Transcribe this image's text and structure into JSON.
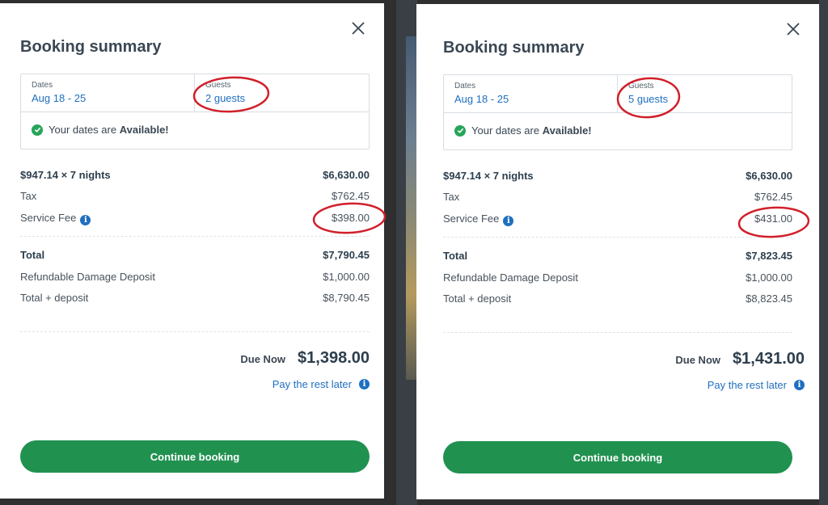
{
  "panels": [
    {
      "title": "Booking summary",
      "dates_label": "Dates",
      "dates_value": "Aug 18 - 25",
      "guests_label": "Guests",
      "guests_value": "2 guests",
      "available_prefix": "Your dates are ",
      "available_bold": "Available!",
      "lines": {
        "nights_label": "$947.14 × 7 nights",
        "nights_value": "$6,630.00",
        "tax_label": "Tax",
        "tax_value": "$762.45",
        "fee_label": "Service Fee",
        "fee_value": "$398.00",
        "total_label": "Total",
        "total_value": "$7,790.45",
        "deposit_label": "Refundable Damage Deposit",
        "deposit_value": "$1,000.00",
        "total_deposit_label": "Total + deposit",
        "total_deposit_value": "$8,790.45"
      },
      "due_label": "Due Now",
      "due_value": "$1,398.00",
      "pay_later": "Pay the rest later",
      "cta": "Continue booking"
    },
    {
      "title": "Booking summary",
      "dates_label": "Dates",
      "dates_value": "Aug 18 - 25",
      "guests_label": "Guests",
      "guests_value": "5 guests",
      "available_prefix": "Your dates are ",
      "available_bold": "Available!",
      "lines": {
        "nights_label": "$947.14 × 7 nights",
        "nights_value": "$6,630.00",
        "tax_label": "Tax",
        "tax_value": "$762.45",
        "fee_label": "Service Fee",
        "fee_value": "$431.00",
        "total_label": "Total",
        "total_value": "$7,823.45",
        "deposit_label": "Refundable Damage Deposit",
        "deposit_value": "$1,000.00",
        "total_deposit_label": "Total + deposit",
        "total_deposit_value": "$8,823.45"
      },
      "due_label": "Due Now",
      "due_value": "$1,431.00",
      "pay_later": "Pay the rest later",
      "cta": "Continue booking"
    }
  ],
  "colors": {
    "accent_blue": "#1f6fc0",
    "cta_green": "#219150",
    "check_green": "#27a55a",
    "annotation_red": "#d0202a"
  },
  "icons": [
    "close-icon",
    "check-circle-icon",
    "info-icon"
  ]
}
